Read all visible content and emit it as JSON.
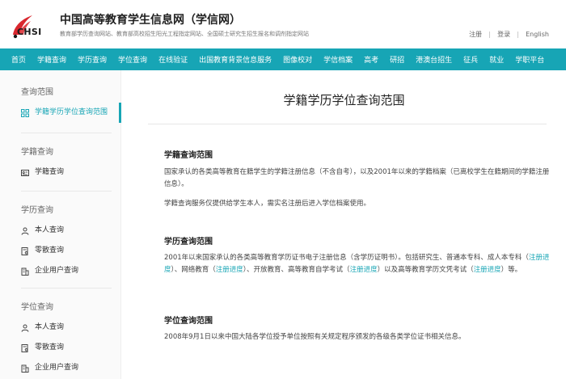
{
  "header": {
    "logo_text": "CHSI",
    "title": "中国高等教育学生信息网（学信网）",
    "subtitle": "教育部学历查询网站、教育部高校招生阳光工程指定网站、全国硕士研究生招生报名和调剂指定网站",
    "links": [
      "注册",
      "登录",
      "English"
    ]
  },
  "nav": {
    "items": [
      "首页",
      "学籍查询",
      "学历查询",
      "学位查询",
      "在线验证",
      "出国教育背景信息服务",
      "图像校对",
      "学信档案",
      "高考",
      "研招",
      "港澳台招生",
      "征兵",
      "就业",
      "学职平台"
    ]
  },
  "sidebar": {
    "groups": [
      {
        "title": "查询范围",
        "items": [
          {
            "label": "学籍学历学位查询范围",
            "icon": "grid-icon"
          }
        ]
      },
      {
        "title": "学籍查询",
        "items": [
          {
            "label": "学籍查询",
            "icon": "id-card-icon"
          }
        ]
      },
      {
        "title": "学历查询",
        "items": [
          {
            "label": "本人查询",
            "icon": "user-icon"
          },
          {
            "label": "零散查询",
            "icon": "document-icon"
          },
          {
            "label": "企业用户查询",
            "icon": "building-icon"
          }
        ]
      },
      {
        "title": "学位查询",
        "items": [
          {
            "label": "本人查询",
            "icon": "user-icon"
          },
          {
            "label": "零散查询",
            "icon": "document-icon"
          },
          {
            "label": "企业用户查询",
            "icon": "building-icon"
          }
        ]
      }
    ]
  },
  "main": {
    "title": "学籍学历学位查询范围",
    "sections": {
      "xueji": {
        "heading": "学籍查询范围",
        "p1": "国家承认的各类高等教育在籍学生的学籍注册信息（不含自考），以及2001年以来的学籍档案（已离校学生在籍期间的学籍注册信息）。",
        "p2": "学籍查询服务仅提供给学生本人，需实名注册后进入学信档案使用。"
      },
      "xueli": {
        "heading": "学历查询范围",
        "t1": "2001年以来国家承认的各类高等教育学历证书电子注册信息（含学历证明书）。包括研究生、普通本专科、成人本专科（",
        "link1": "注册进度",
        "t2": "）、网络教育（",
        "link2": "注册进度",
        "t3": "）、开放教育、高等教育自学考试（",
        "link3": "注册进度",
        "t4": "）以及高等教育学历文凭考试（",
        "link4": "注册进度",
        "t5": "）等。"
      },
      "xuewei": {
        "heading": "学位查询范围",
        "p1": "2008年9月1日以来中国大陆各学位授予单位按照有关规定程序颁发的各级各类学位证书相关信息。"
      }
    }
  },
  "colors": {
    "accent": "#17a5b5",
    "logo_red": "#d9272e"
  }
}
